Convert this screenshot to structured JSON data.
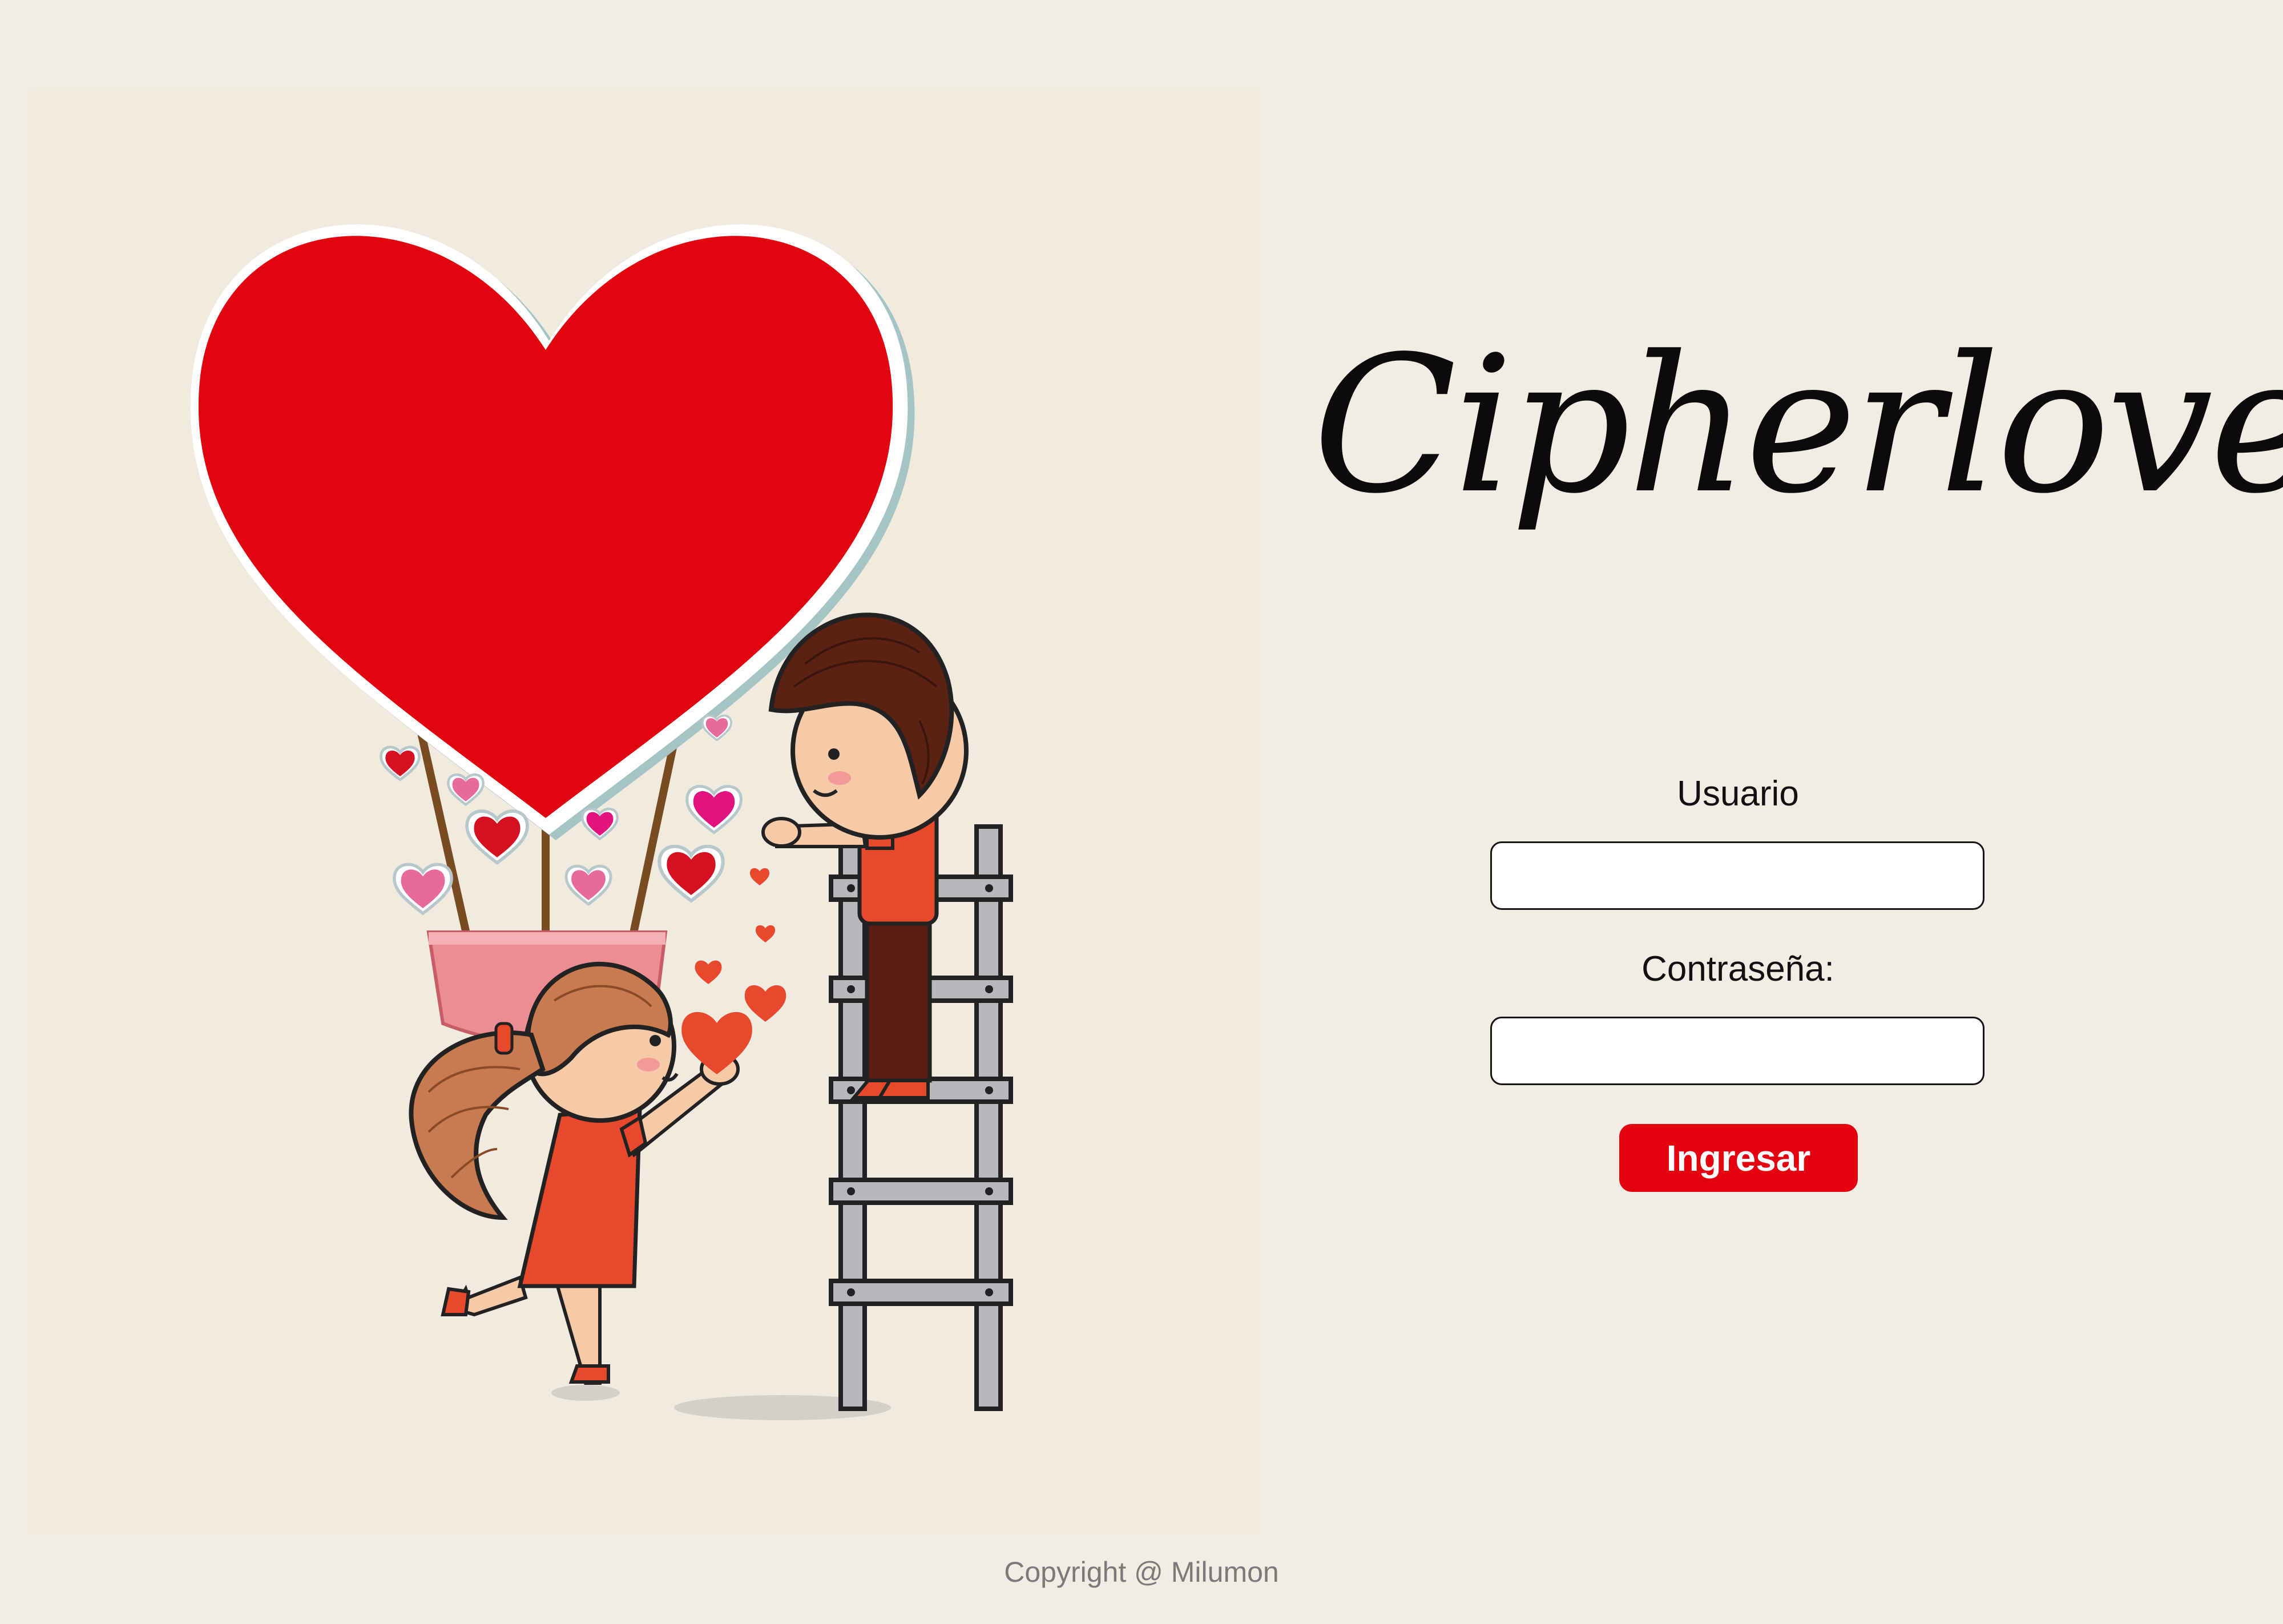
{
  "login": {
    "app_title": "Cipherlove",
    "username_label": "Usuario",
    "username_value": "",
    "password_label": "Contraseña:",
    "password_value": "",
    "submit_label": "Ingresar"
  },
  "footer": {
    "copyright": "Copyright @ Milumon"
  },
  "colors": {
    "page_background": "#f2ede2",
    "accent_red": "#e3000f",
    "text": "#111111",
    "footer_text": "#7a7a7a"
  }
}
